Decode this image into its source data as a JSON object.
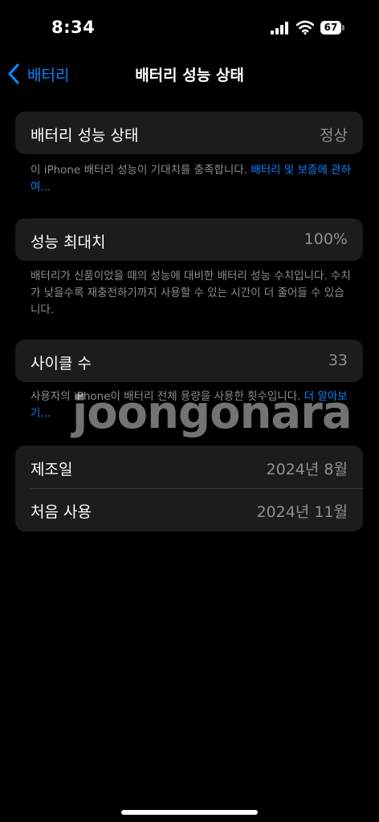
{
  "status": {
    "time": "8:34",
    "battery_level": "67",
    "signal_icon": "cellular-signal-icon",
    "wifi_icon": "wifi-icon",
    "battery_icon": "battery-icon"
  },
  "nav": {
    "back_label": "배터리",
    "title": "배터리 성능 상태",
    "back_icon": "chevron-left-icon"
  },
  "health": {
    "label": "배터리 성능 상태",
    "value": "정상",
    "note": "이 iPhone 배터리 성능이 기대치를 충족합니다.",
    "link": "배터리 및 보증에 관하여..."
  },
  "max_capacity": {
    "label": "성능 최대치",
    "value": "100%",
    "note": "배터리가 신품이었을 때의 성능에 대비한 배터리 성능 수치입니다. 수치가 낮을수록 재충전하기까지 사용할 수 있는 시간이 더 줄어들 수 있습니다."
  },
  "cycle": {
    "label": "사이클 수",
    "value": "33",
    "note": "사용자의 iPhone이 배터리 전체 용량을 사용한 횟수입니다.",
    "link": "더 알아보기..."
  },
  "dates": {
    "manufacture_label": "제조일",
    "manufacture_value": "2024년 8월",
    "first_use_label": "처음 사용",
    "first_use_value": "2024년 11월"
  },
  "watermark": "joongonara",
  "colors": {
    "background": "#000000",
    "card": "#1c1c1e",
    "accent": "#0a84ff",
    "secondary_text": "#8e8e93"
  }
}
